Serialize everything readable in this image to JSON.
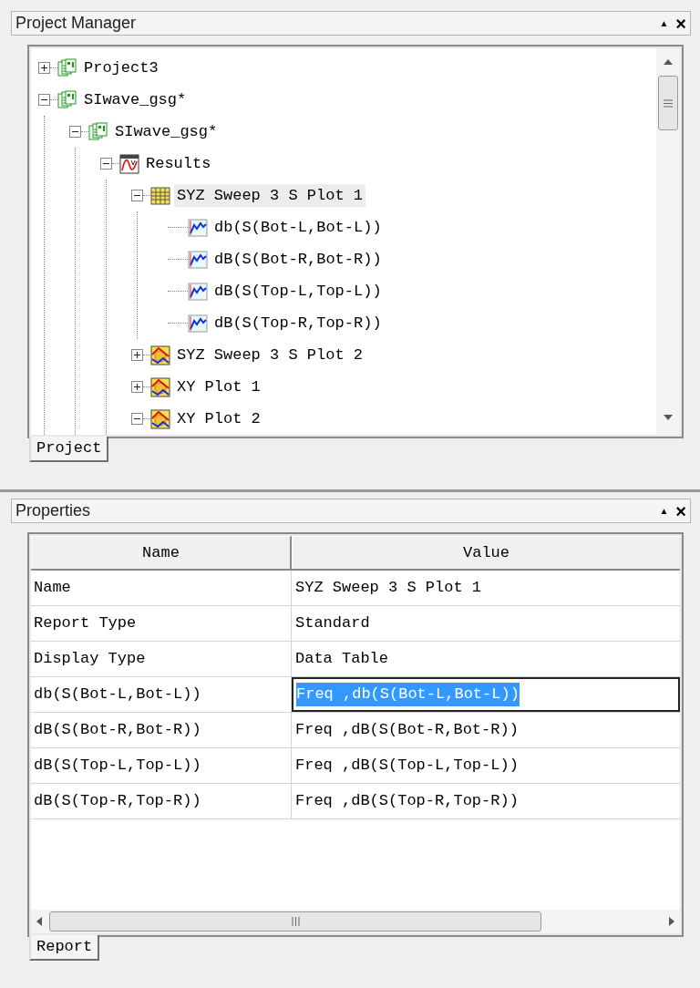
{
  "project_manager": {
    "title": "Project Manager",
    "buttons": [
      "▲",
      "×"
    ],
    "tree": [
      {
        "label": "Project3",
        "kind": "project",
        "expanded": false,
        "selected": false
      },
      {
        "label": "SIwave_gsg*",
        "kind": "project",
        "expanded": true,
        "selected": false,
        "children": [
          {
            "label": "SIwave_gsg*",
            "kind": "project",
            "expanded": true,
            "selected": false,
            "children": [
              {
                "label": "Results",
                "kind": "results",
                "expanded": true,
                "selected": false,
                "children": [
                  {
                    "label": "SYZ Sweep 3 S Plot 1",
                    "kind": "table",
                    "expanded": true,
                    "selected": true,
                    "children": [
                      {
                        "label": "db(S(Bot-L,Bot-L))",
                        "kind": "trace",
                        "selected": false
                      },
                      {
                        "label": "dB(S(Bot-R,Bot-R))",
                        "kind": "trace",
                        "selected": false
                      },
                      {
                        "label": "dB(S(Top-L,Top-L))",
                        "kind": "trace",
                        "selected": false
                      },
                      {
                        "label": "dB(S(Top-R,Top-R))",
                        "kind": "trace",
                        "selected": false
                      }
                    ]
                  },
                  {
                    "label": "SYZ Sweep 3 S Plot 2",
                    "kind": "plot",
                    "expanded": false,
                    "selected": false
                  },
                  {
                    "label": "XY Plot 1",
                    "kind": "plot",
                    "expanded": false,
                    "selected": false
                  },
                  {
                    "label": "XY Plot 2",
                    "kind": "plot",
                    "expanded": true,
                    "selected": false
                  }
                ]
              }
            ]
          }
        ]
      }
    ],
    "tabs": [
      {
        "label": "Project",
        "selected": true
      }
    ]
  },
  "properties": {
    "title": "Properties",
    "buttons": [
      "▲",
      "×"
    ],
    "columns": [
      "Name",
      "Value"
    ],
    "rows": [
      {
        "name": "Name",
        "value": "SYZ Sweep 3 S Plot 1",
        "editing": false
      },
      {
        "name": "Report Type",
        "value": "Standard",
        "editing": false
      },
      {
        "name": "Display Type",
        "value": "Data Table",
        "editing": false
      },
      {
        "name": "db(S(Bot-L,Bot-L))",
        "value": "Freq ,db(S(Bot-L,Bot-L))",
        "editing": true
      },
      {
        "name": "dB(S(Bot-R,Bot-R))",
        "value": "Freq ,dB(S(Bot-R,Bot-R))",
        "editing": false
      },
      {
        "name": "dB(S(Top-L,Top-L))",
        "value": "Freq ,dB(S(Top-L,Top-L))",
        "editing": false
      },
      {
        "name": "dB(S(Top-R,Top-R))",
        "value": "Freq ,dB(S(Top-R,Top-R))",
        "editing": false
      }
    ],
    "tabs": [
      {
        "label": "Report",
        "selected": true
      }
    ]
  }
}
